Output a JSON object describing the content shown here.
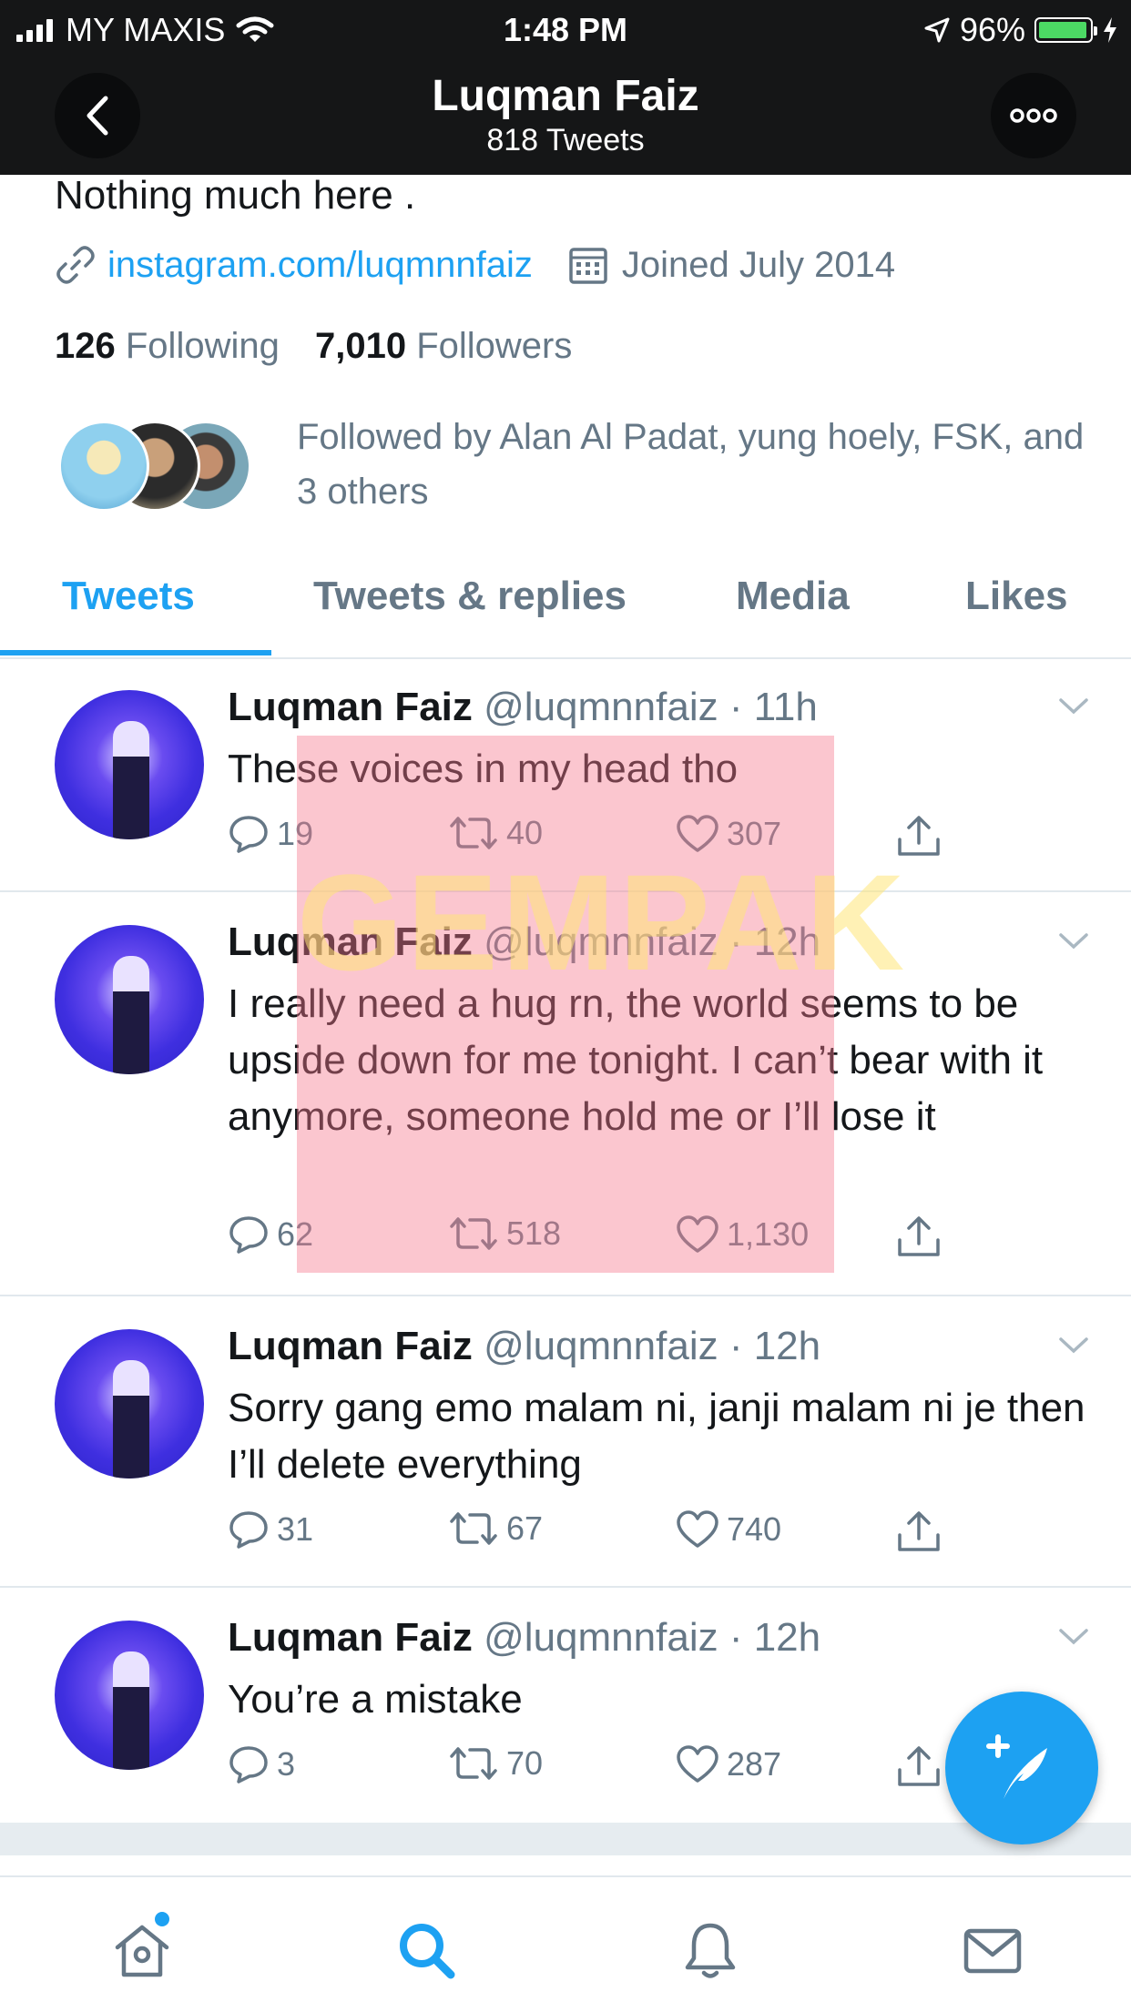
{
  "status_bar": {
    "carrier": "MY MAXIS",
    "time": "1:48 PM",
    "battery": "96%",
    "battery_level": 0.96
  },
  "header": {
    "name": "Luqman Faiz",
    "tweet_count": "818 Tweets"
  },
  "profile": {
    "bio": "Nothing much here .",
    "link": "instagram.com/luqmnnfaiz",
    "joined": "Joined July 2014",
    "following_count": "126",
    "following_label": "Following",
    "followers_count": "7,010",
    "followers_label": "Followers",
    "followed_by": "Followed by Alan Al Padat, yung hoely, FSK, and 3 others"
  },
  "tabs": [
    "Tweets",
    "Tweets & replies",
    "Media",
    "Likes"
  ],
  "tweets": [
    {
      "name": "Luqman Faiz",
      "handle": "@luqmnnfaiz",
      "time": "11h",
      "text": "These voices in my head tho",
      "replies": "19",
      "retweets": "40",
      "likes": "307"
    },
    {
      "name": "Luqman Faiz",
      "handle": "@luqmnnfaiz",
      "time": "12h",
      "text": "I really need a hug rn, the world seems to be upside down for me tonight. I can’t bear with it anymore, someone hold me or I’ll lose it",
      "replies": "62",
      "retweets": "518",
      "likes": "1,130"
    },
    {
      "name": "Luqman Faiz",
      "handle": "@luqmnnfaiz",
      "time": "12h",
      "text": "Sorry gang emo malam ni, janji malam ni je then I’ll delete everything",
      "replies": "31",
      "retweets": "67",
      "likes": "740"
    },
    {
      "name": "Luqman Faiz",
      "handle": "@luqmnnfaiz",
      "time": "12h",
      "text": "You’re a mistake",
      "replies": "3",
      "retweets": "70",
      "likes": "287"
    }
  ],
  "watermark": "GEMPAK",
  "colors": {
    "accent": "#1da1f2",
    "header_bg": "#151617",
    "muted": "#657786"
  },
  "icons": [
    "back-icon",
    "more-icon",
    "link-icon",
    "calendar-icon",
    "reply-icon",
    "retweet-icon",
    "like-icon",
    "share-icon",
    "caret-icon",
    "compose-icon",
    "home-icon",
    "search-icon",
    "notifications-icon",
    "messages-icon"
  ]
}
